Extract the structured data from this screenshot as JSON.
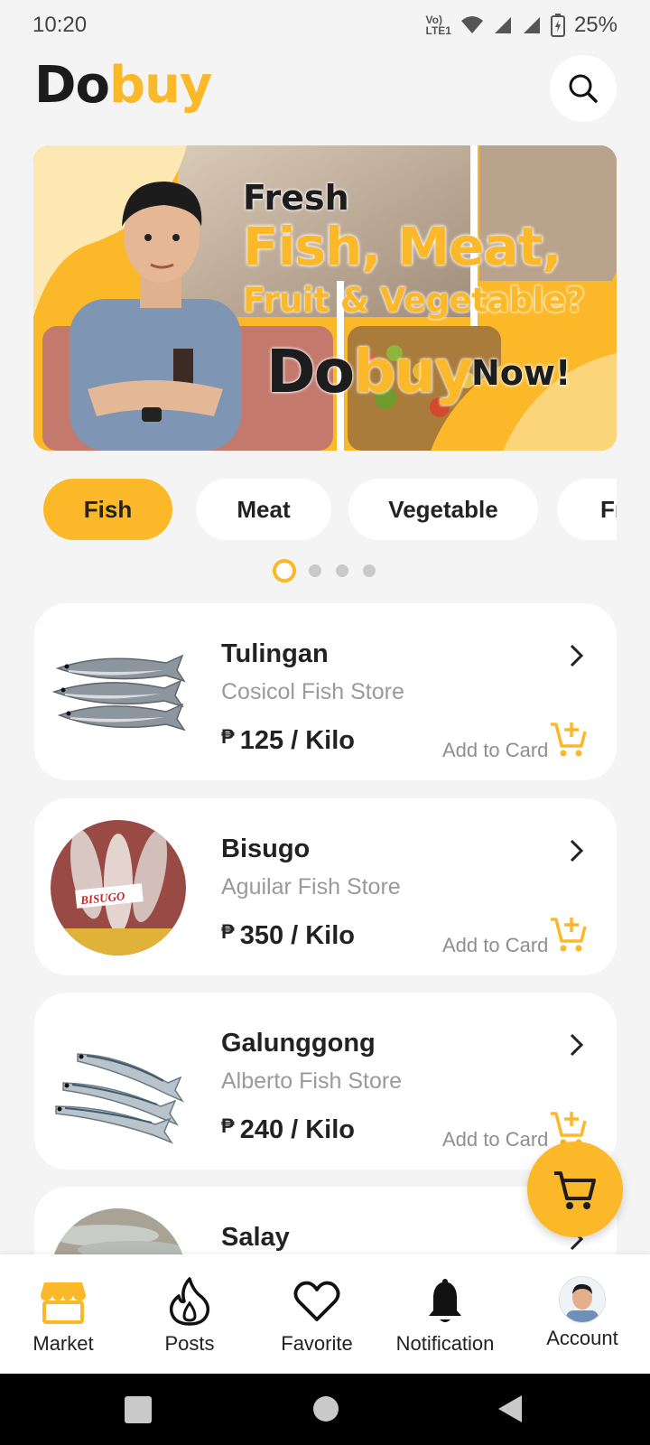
{
  "status_bar": {
    "time": "10:20",
    "battery": "25%",
    "network": "Vo) LTE1"
  },
  "header": {
    "logo_part1": "Do",
    "logo_part2": "buy"
  },
  "banner": {
    "line1": "Fresh",
    "line2": "Fish, Meat,",
    "line3": "Fruit & Vegetable?",
    "brand_part1": "Do",
    "brand_part2": "buy",
    "cta": "Now!"
  },
  "categories": [
    {
      "label": "Fish",
      "active": true
    },
    {
      "label": "Meat",
      "active": false
    },
    {
      "label": "Vegetable",
      "active": false
    },
    {
      "label": "Fr",
      "active": false
    }
  ],
  "carousel": {
    "pages": 4,
    "current": 1
  },
  "products": [
    {
      "name": "Tulingan",
      "store": "Cosicol Fish Store",
      "currency": "₱",
      "price": "125 / Kilo",
      "add_label": "Add to Card"
    },
    {
      "name": "Bisugo",
      "store": "Aguilar Fish Store",
      "currency": "₱",
      "price": "350 / Kilo",
      "add_label": "Add to Card",
      "image_label": "BISUGO"
    },
    {
      "name": "Galunggong",
      "store": "Alberto Fish Store",
      "currency": "₱",
      "price": "240 / Kilo",
      "add_label": "Add to Card"
    },
    {
      "name": "Salay"
    }
  ],
  "bottom_nav": [
    {
      "label": "Market",
      "icon": "store-icon",
      "active": true
    },
    {
      "label": "Posts",
      "icon": "flame-icon",
      "active": false
    },
    {
      "label": "Favorite",
      "icon": "heart-icon",
      "active": false
    },
    {
      "label": "Notification",
      "icon": "bell-icon",
      "active": false
    },
    {
      "label": "Account",
      "icon": "avatar",
      "active": false
    }
  ],
  "colors": {
    "accent": "#fbb828",
    "background": "#f4f4f4",
    "card": "#ffffff",
    "text": "#222222",
    "muted": "#9a9a9a"
  }
}
